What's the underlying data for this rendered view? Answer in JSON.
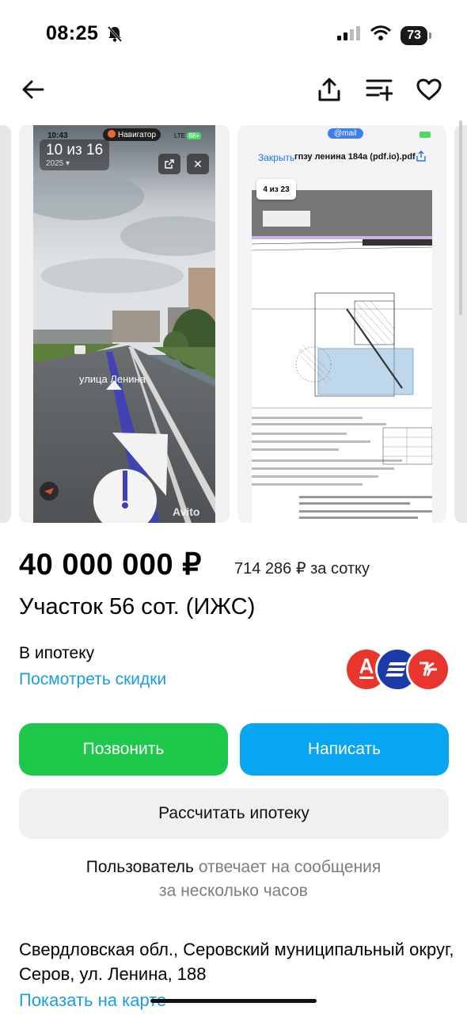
{
  "status_bar": {
    "time": "08:25",
    "battery": "73"
  },
  "nav": {
    "back": "arrow-left-icon",
    "share": "share-icon",
    "compare": "compare-icon",
    "favorite": "heart-icon"
  },
  "gallery": {
    "counter": "10 из 16",
    "photo": {
      "time": "10:43",
      "navigator": "Навигатор",
      "year": "2025",
      "street_label": "улица Ленина",
      "watermark": "Avito",
      "signal": "LTE",
      "battery": "88+"
    },
    "doc": {
      "mail": "@mail",
      "close": "Закрыть",
      "file_name": "гпзу ленина 184а (pdf.io).pdf",
      "page_counter": "4 из 23"
    }
  },
  "listing": {
    "price": "40 000 000 ₽",
    "price_per": "714 286 ₽ за сотку",
    "title": "Участок 56 сот. (ИЖС)",
    "mortgage_label": "В ипотеку",
    "discounts_link": "Посмотреть скидки",
    "banks": [
      {
        "name": "Альфа-Банк",
        "letter": "А",
        "color": "#e8352d"
      },
      {
        "name": "bank-2",
        "letter": "",
        "color": "#1c3aa8"
      },
      {
        "name": "bank-3",
        "letter": "",
        "color": "#e8352d"
      }
    ],
    "buttons": {
      "call": "Позвонить",
      "write": "Написать",
      "calc": "Рассчитать ипотеку"
    },
    "reply": {
      "who": "Пользователь",
      "rest_line1": " отвечает на сообщения",
      "line2": "за несколько часов"
    },
    "address": "Свердловская обл., Серовский муниципальный округ, Серов, ул. Ленина, 188",
    "show_map": "Показать на карте"
  },
  "colors": {
    "green": "#1ec84b",
    "blue": "#07a5f2",
    "link": "#1a9ee3"
  }
}
